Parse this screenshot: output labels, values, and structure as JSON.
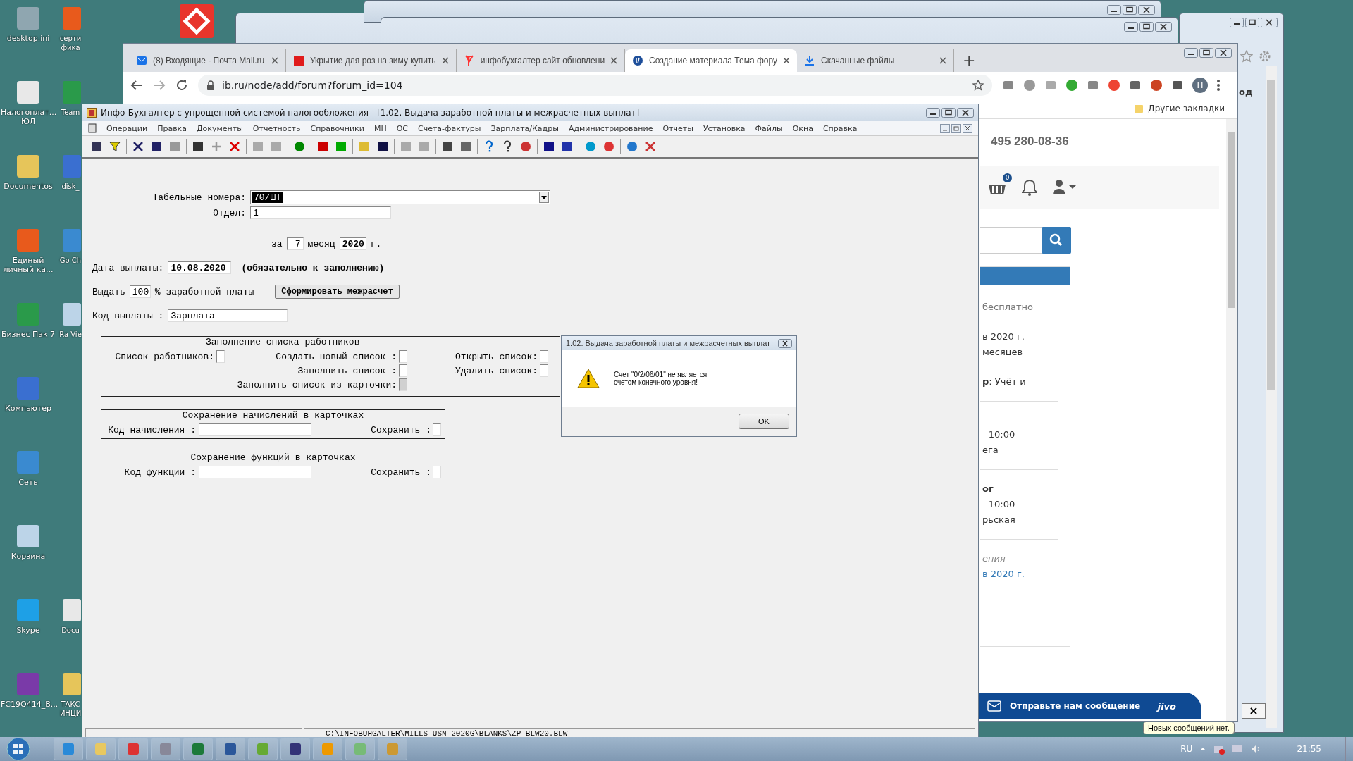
{
  "desktop": {
    "icons": [
      {
        "label": "desktop.ini"
      },
      {
        "label": "Налогоплат... ЮЛ"
      },
      {
        "label": "Documentos"
      },
      {
        "label": "Единый личный ка..."
      },
      {
        "label": "Бизнес Пак 7"
      },
      {
        "label": "Компьютер"
      },
      {
        "label": "Сеть"
      },
      {
        "label": "Корзина"
      },
      {
        "label": "Skype"
      },
      {
        "label": "FC19Q414_B..."
      }
    ],
    "icons_partial": [
      {
        "kind": "icon",
        "label": "сертифика"
      },
      {
        "kind": "icon",
        "label": "Team"
      },
      {
        "kind": "icon",
        "label": "disk_"
      },
      {
        "kind": "icon",
        "label": "Go Ch"
      },
      {
        "kind": "icon",
        "label": "Ra Vie"
      },
      {
        "kind": "gap"
      },
      {
        "kind": "gap"
      },
      {
        "kind": "gap"
      },
      {
        "kind": "icon",
        "label": "Docu"
      },
      {
        "kind": "icon",
        "label": "ТАКС ИНЦИ"
      }
    ]
  },
  "back_window": {
    "text": "од"
  },
  "browser": {
    "tabs": [
      {
        "title": "(8) Входящие - Почта Mail.ru",
        "selected": false
      },
      {
        "title": "Укрытие для роз на зиму купить",
        "selected": false
      },
      {
        "title": "инфобухгалтер сайт обновлени",
        "selected": false
      },
      {
        "title": "Создание материала Тема фору",
        "selected": true
      },
      {
        "title": "Скачанные файлы",
        "selected": false
      }
    ],
    "new_tab": "+",
    "address": "ib.ru/node/add/forum?forum_id=104",
    "profile_initial": "Н",
    "bookmark": "Другие закладки",
    "page": {
      "phone": "495 280-08-36",
      "cart_count": "0",
      "lines": [
        {
          "kind": "muted",
          "text": "бесплатно"
        },
        {
          "kind": "gap"
        },
        {
          "kind": "text",
          "text": "в 2020 г."
        },
        {
          "kind": "text",
          "text": "месяцев"
        },
        {
          "kind": "gap"
        },
        {
          "kind": "text",
          "text": "**р**: Учёт и"
        },
        {
          "kind": "rule"
        },
        {
          "kind": "gap"
        },
        {
          "kind": "text",
          "text": "- 10:00"
        },
        {
          "kind": "text",
          "text": "ега"
        },
        {
          "kind": "rule"
        },
        {
          "kind": "bold",
          "text": "ог"
        },
        {
          "kind": "text",
          "text": "- 10:00"
        },
        {
          "kind": "text",
          "text": "рьская"
        },
        {
          "kind": "rule"
        },
        {
          "kind": "italic",
          "text": "ения"
        },
        {
          "kind": "link",
          "text": "в 2020 г."
        }
      ]
    },
    "chat": {
      "label": "Отправьте нам сообщение",
      "brand": "jivo",
      "tooltip": "Новых сообщений нет.",
      "close": "×"
    }
  },
  "app": {
    "title": "Инфо-Бухгалтер с упрощенной системой налогообложения - [1.02. Выдача заработной платы и межрасчетных выплат]",
    "menu": [
      "Операции",
      "Правка",
      "Документы",
      "Отчетность",
      "Справочники",
      "МН",
      "ОС",
      "Счета-фактуры",
      "Зарплата/Кадры",
      "Администрирование",
      "Отчеты",
      "Установка",
      "Файлы",
      "Окна",
      "Справка"
    ],
    "form": {
      "staff": {
        "label": "Табельные номера:",
        "value": "70/ШТ"
      },
      "department": {
        "label": "Отдел:",
        "value": "1"
      },
      "period": {
        "prefix": "за",
        "month": "7",
        "month_label": "месяц",
        "year": "2020",
        "suffix": "г."
      },
      "pay_date": {
        "label": "Дата выплаты:",
        "value": "10.08.2020",
        "note": "(обязательно к заполнению)"
      },
      "issue": {
        "label": "Выдать",
        "value": "100",
        "suffix": "% заработной платы"
      },
      "action_button": "Сформировать межрасчет",
      "pay_code": {
        "label": "Код выплаты :",
        "value": "Зарплата"
      },
      "list_group": {
        "title": "Заполнение списка работников",
        "columns": [
          [
            {
              "label": "Список работников:",
              "checked": false,
              "disabled": false
            }
          ],
          [
            {
              "label": "Создать новый список :",
              "checked": false,
              "disabled": false
            },
            {
              "label": "Заполнить список :",
              "checked": false,
              "disabled": false
            },
            {
              "label": "Заполнить список из карточки:",
              "checked": false,
              "disabled": true
            }
          ],
          [
            {
              "label": "Открыть список:",
              "checked": false,
              "disabled": false
            },
            {
              "label": "Удалить список:",
              "checked": false,
              "disabled": false
            }
          ]
        ]
      },
      "save_groups": [
        {
          "title": "Сохранение начислений в карточках",
          "field_label": "Код начисления :",
          "check_label": "Сохранить :",
          "checked": false
        },
        {
          "title": "Сохранение функций в карточках",
          "field_label": "Код функции :",
          "check_label": "Сохранить :",
          "checked": false
        }
      ]
    },
    "status_path": "C:\\INFOBUHGALTER\\MILLS_USN_2020G\\BLANKS\\ZP_BLW20.BLW",
    "dialog": {
      "title": "1.02. Выдача заработной платы и межрасчетных выплат",
      "lines": [
        "Счет \"0/2/06/01\" не является",
        "счетом конечного уровня!"
      ],
      "button": "OK"
    }
  },
  "taskbar": {
    "language": "RU",
    "clock": "21:55"
  }
}
